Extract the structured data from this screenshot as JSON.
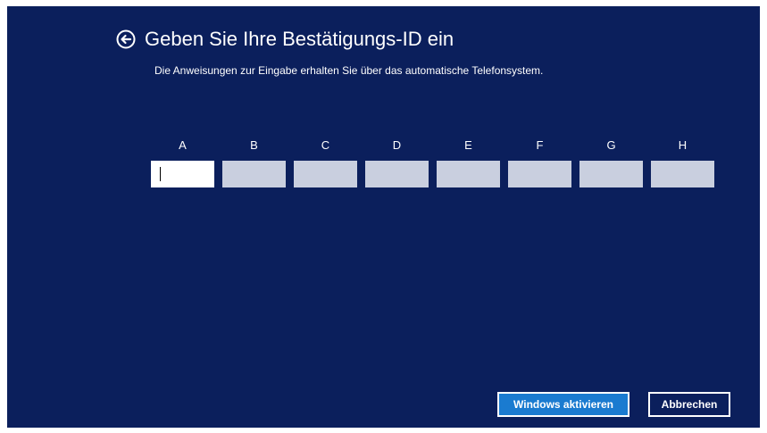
{
  "colors": {
    "background": "#0b1f5c",
    "text": "#ffffff",
    "input_inactive": "#c9cfdf",
    "input_active": "#ffffff",
    "primary_button": "#1a7bd0"
  },
  "header": {
    "back_icon": "back-arrow-circle-icon",
    "title": "Geben Sie Ihre Bestätigungs-ID ein",
    "subtitle": "Die Anweisungen zur Eingabe erhalten Sie über das automatische Telefonsystem."
  },
  "confirmation_fields": [
    {
      "label": "A",
      "value": "",
      "active": true
    },
    {
      "label": "B",
      "value": "",
      "active": false
    },
    {
      "label": "C",
      "value": "",
      "active": false
    },
    {
      "label": "D",
      "value": "",
      "active": false
    },
    {
      "label": "E",
      "value": "",
      "active": false
    },
    {
      "label": "F",
      "value": "",
      "active": false
    },
    {
      "label": "G",
      "value": "",
      "active": false
    },
    {
      "label": "H",
      "value": "",
      "active": false
    }
  ],
  "buttons": {
    "activate": "Windows aktivieren",
    "cancel": "Abbrechen"
  }
}
